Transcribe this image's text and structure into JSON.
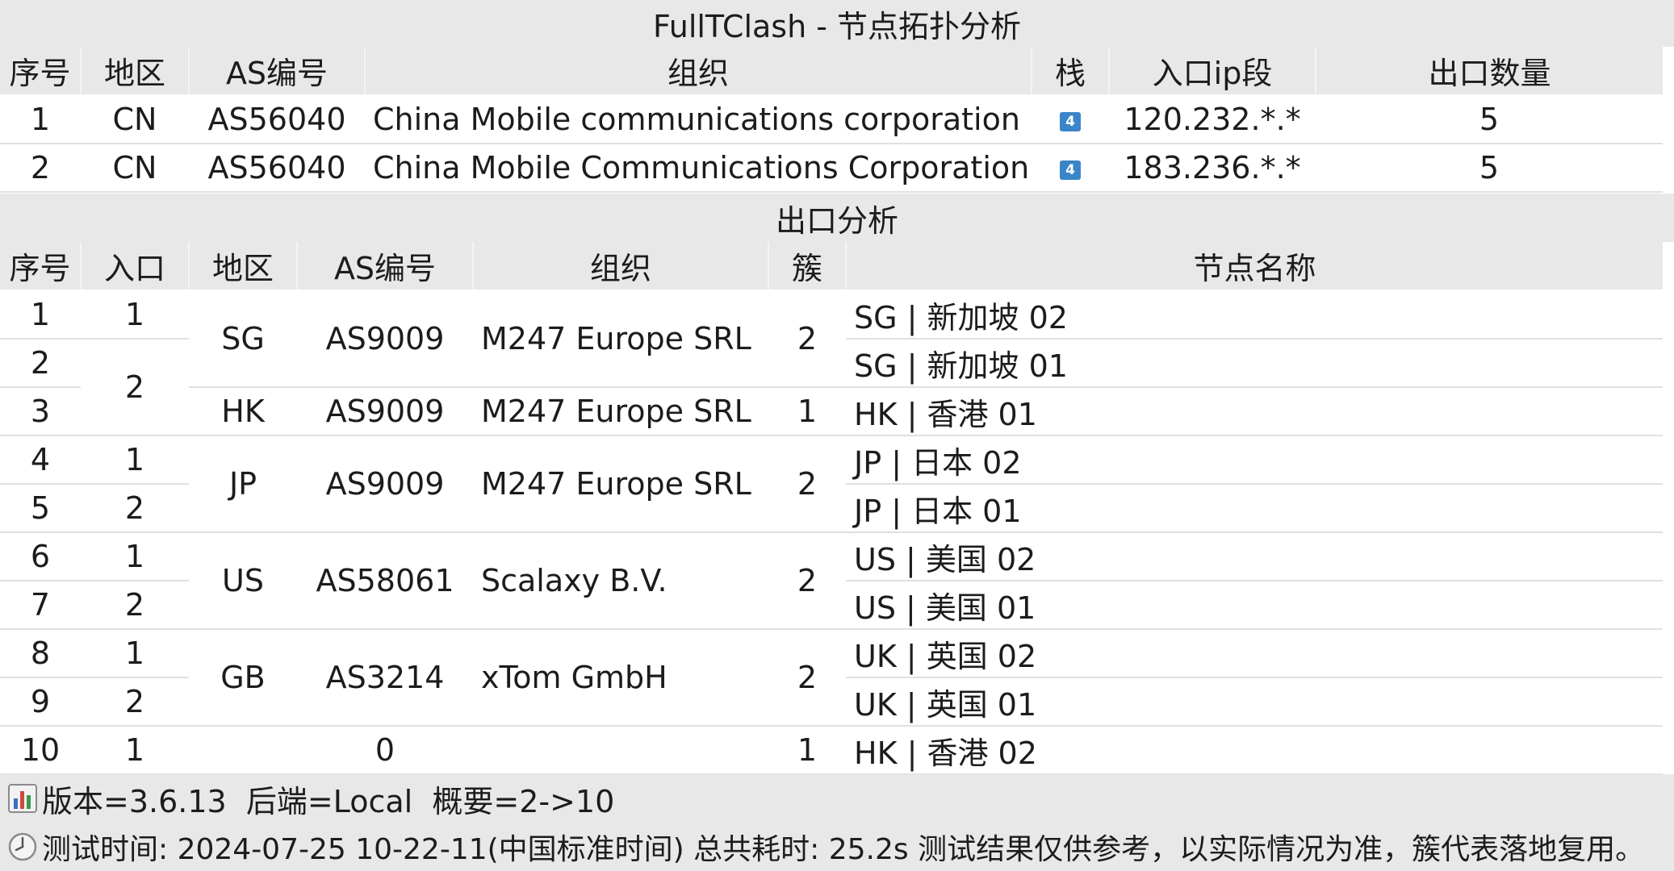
{
  "title": "FullTClash - 节点拓扑分析",
  "topology": {
    "headers": [
      "序号",
      "地区",
      "AS编号",
      "组织",
      "栈",
      "入口ip段",
      "出口数量"
    ],
    "rows": [
      {
        "no": "1",
        "region": "CN",
        "asn": "AS56040",
        "org": "China Mobile communications corporation",
        "stack": "4",
        "ip": "120.232.*.*",
        "count": "5"
      },
      {
        "no": "2",
        "region": "CN",
        "asn": "AS56040",
        "org": "China Mobile Communications Corporation",
        "stack": "4",
        "ip": "183.236.*.*",
        "count": "5"
      }
    ]
  },
  "exit_section_title": "出口分析",
  "exit": {
    "headers": [
      "序号",
      "入口",
      "地区",
      "AS编号",
      "组织",
      "簇",
      "节点名称"
    ],
    "rows": [
      {
        "no": "1",
        "entry": "1",
        "region": "SG",
        "asn": "AS9009",
        "org": "M247 Europe SRL",
        "cluster": "2",
        "node": "SG | 新加坡 02"
      },
      {
        "no": "2",
        "entry": "2",
        "node": "SG | 新加坡 01"
      },
      {
        "no": "3",
        "region": "HK",
        "asn": "AS9009",
        "org": "M247 Europe SRL",
        "cluster": "1",
        "node": "HK | 香港 01"
      },
      {
        "no": "4",
        "entry": "1",
        "region": "JP",
        "asn": "AS9009",
        "org": "M247 Europe SRL",
        "cluster": "2",
        "node": "JP | 日本 02"
      },
      {
        "no": "5",
        "entry": "2",
        "node": "JP | 日本 01"
      },
      {
        "no": "6",
        "entry": "1",
        "region": "US",
        "asn": "AS58061",
        "org": "Scalaxy B.V.",
        "cluster": "2",
        "node": "US | 美国 02"
      },
      {
        "no": "7",
        "entry": "2",
        "node": "US | 美国 01"
      },
      {
        "no": "8",
        "entry": "1",
        "region": "GB",
        "asn": "AS3214",
        "org": "xTom GmbH",
        "cluster": "2",
        "node": "UK | 英国 02"
      },
      {
        "no": "9",
        "entry": "2",
        "node": "UK | 英国 01"
      },
      {
        "no": "10",
        "entry": "1",
        "region": "",
        "asn": "0",
        "org": "",
        "cluster": "1",
        "node": "HK | 香港 02"
      }
    ]
  },
  "footer": {
    "version_icon": "bar-chart-icon",
    "version_line": "版本=3.6.13  后端=Local  概要=2->10",
    "time_icon": "clock-icon",
    "time_line": "测试时间: 2024-07-25 10-22-11(中国标准时间) 总共耗时: 25.2s 测试结果仅供参考，以实际情况为准，簇代表落地复用。"
  }
}
